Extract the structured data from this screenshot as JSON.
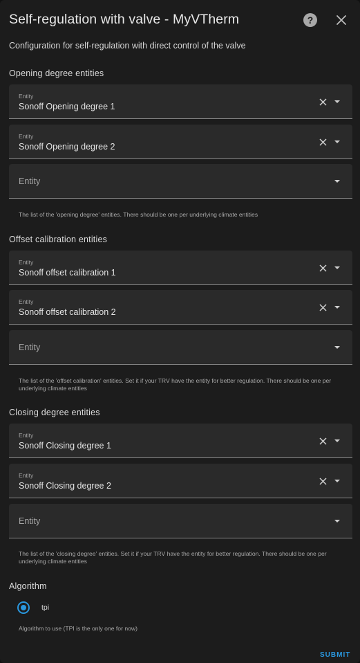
{
  "dialog": {
    "title": "Self-regulation with valve - MyVTherm",
    "description": "Configuration for self-regulation with direct control of the valve",
    "help_icon": "help-circle-icon",
    "close_icon": "close-icon"
  },
  "opening": {
    "title": "Opening degree entities",
    "fields": [
      {
        "label": "Entity",
        "value": "Sonoff Opening degree 1"
      },
      {
        "label": "Entity",
        "value": "Sonoff Opening degree 2"
      },
      {
        "placeholder": "Entity"
      }
    ],
    "helper": "The list of the 'opening degree' entities. There should be one per underlying climate entities"
  },
  "offset": {
    "title": "Offset calibration entities",
    "fields": [
      {
        "label": "Entity",
        "value": "Sonoff offset calibration 1"
      },
      {
        "label": "Entity",
        "value": "Sonoff offset calibration 2"
      },
      {
        "placeholder": "Entity"
      }
    ],
    "helper": "The list of the 'offset calibration' entities. Set it if your TRV have the entity for better regulation. There should be one per underlying climate entities"
  },
  "closing": {
    "title": "Closing degree entities",
    "fields": [
      {
        "label": "Entity",
        "value": "Sonoff Closing degree 1"
      },
      {
        "label": "Entity",
        "value": "Sonoff Closing degree 2"
      },
      {
        "placeholder": "Entity"
      }
    ],
    "helper": "The list of the 'closing degree' entities. Set it if your TRV have the entity for better regulation. There should be one per underlying climate entities"
  },
  "algorithm": {
    "title": "Algorithm",
    "option_label": "tpi",
    "selected": true,
    "helper": "Algorithm to use (TPI is the only one for now)"
  },
  "actions": {
    "submit_label": "SUBMIT"
  },
  "colors": {
    "accent": "#2a98e0",
    "background": "#1c1c1c",
    "field_background": "#2a2a2a"
  }
}
